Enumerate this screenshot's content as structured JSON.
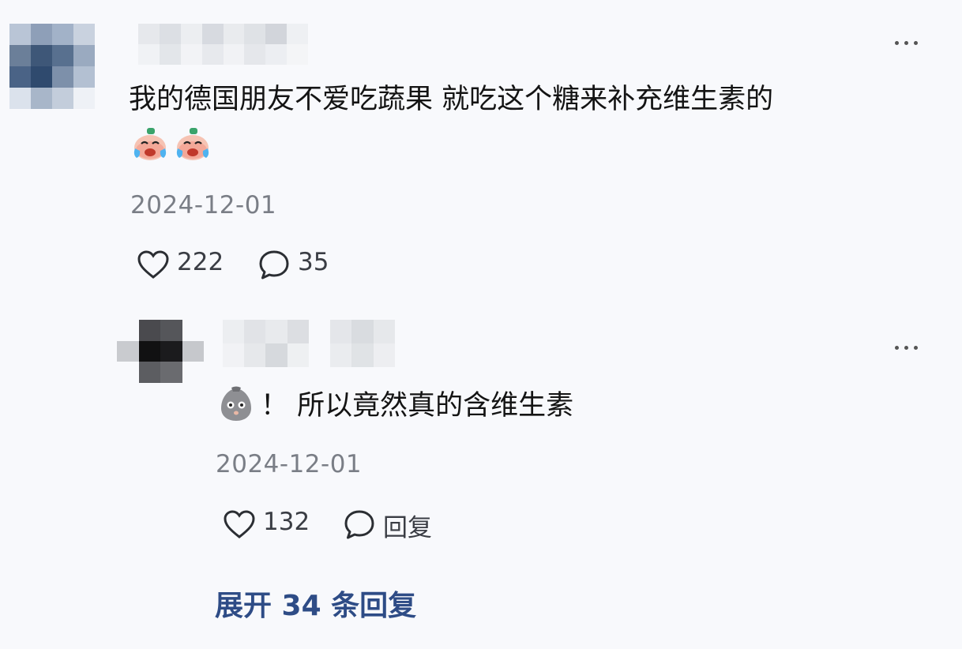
{
  "comment": {
    "text": "我的德国朋友不爱吃蔬果 就吃这个糖来补充维生素的",
    "emojis": [
      "crying-laugh-face-icon",
      "crying-laugh-face-icon"
    ],
    "date": "2024-12-01",
    "like_count": "222",
    "reply_count": "35"
  },
  "reply": {
    "emoji": "sweating-face-icon",
    "text": "！ 所以竟然真的含维生素",
    "date": "2024-12-01",
    "like_count": "132",
    "reply_label": "回复"
  },
  "expand_label": "展开 34 条回复",
  "colors": {
    "background": "#f8f9fc",
    "link": "#2e4c86",
    "date": "#7a7e86"
  }
}
